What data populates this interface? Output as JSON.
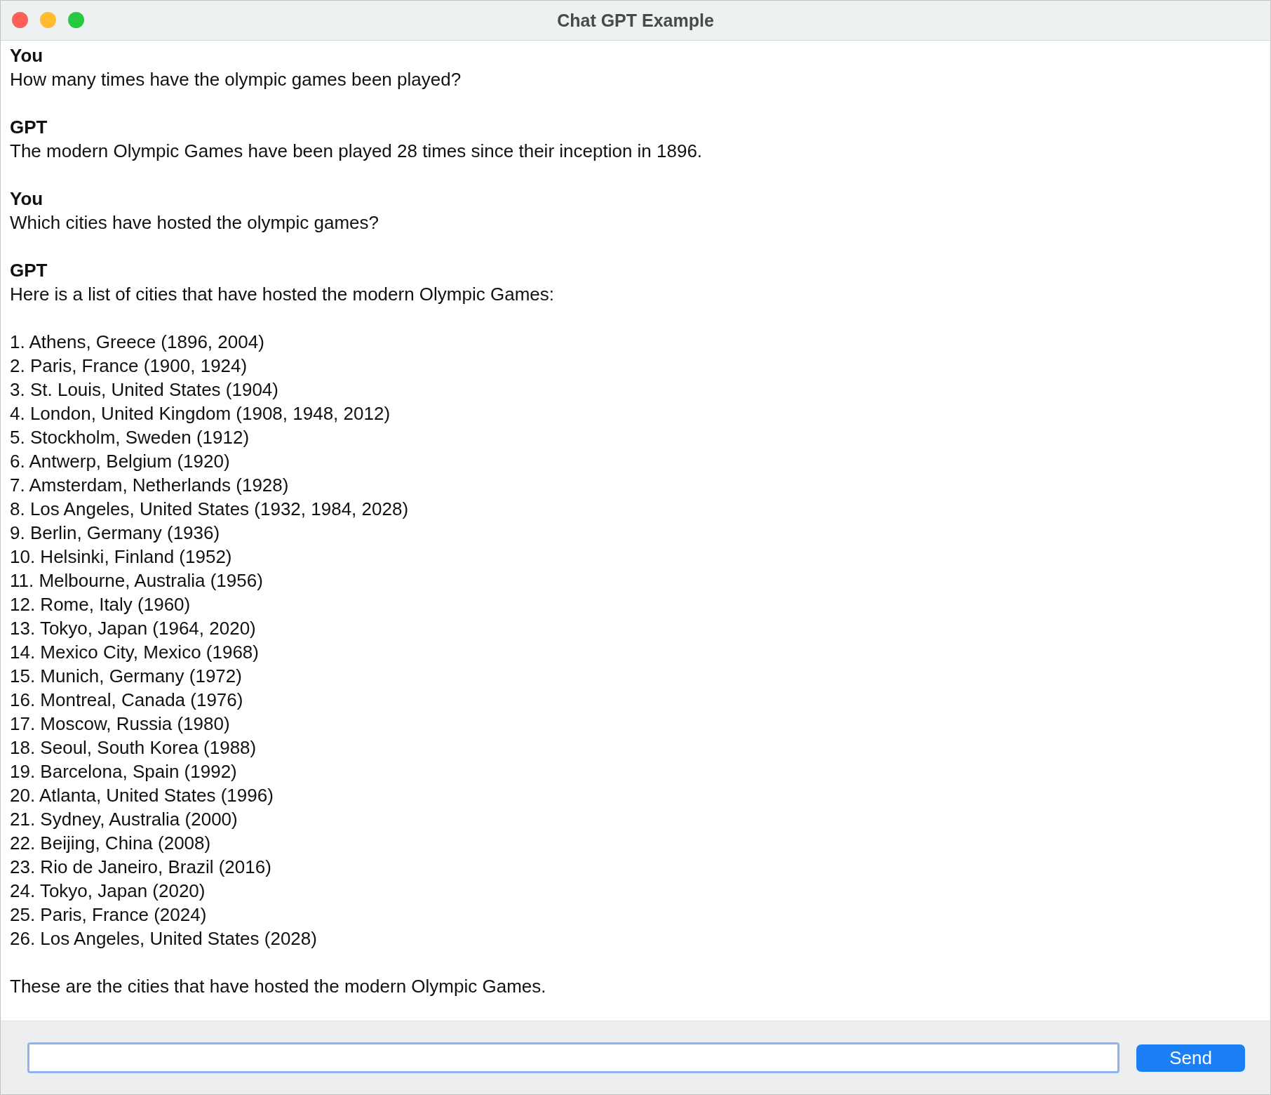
{
  "window": {
    "title": "Chat GPT Example"
  },
  "messages": [
    {
      "author": "You",
      "blocks": [
        {
          "kind": "text",
          "text": "How many times have the olympic games been played?"
        }
      ]
    },
    {
      "author": "GPT",
      "blocks": [
        {
          "kind": "text",
          "text": "The modern Olympic Games have been played 28 times since their inception in 1896."
        }
      ]
    },
    {
      "author": "You",
      "blocks": [
        {
          "kind": "text",
          "text": "Which cities have hosted the olympic games?"
        }
      ]
    },
    {
      "author": "GPT",
      "blocks": [
        {
          "kind": "text",
          "text": "Here is a list of cities that have hosted the modern Olympic Games:"
        },
        {
          "kind": "list",
          "items": [
            "1. Athens, Greece (1896, 2004)",
            "2. Paris, France (1900, 1924)",
            "3. St. Louis, United States (1904)",
            "4. London, United Kingdom (1908, 1948, 2012)",
            "5. Stockholm, Sweden (1912)",
            "6. Antwerp, Belgium (1920)",
            "7. Amsterdam, Netherlands (1928)",
            "8. Los Angeles, United States (1932, 1984, 2028)",
            "9. Berlin, Germany (1936)",
            "10. Helsinki, Finland (1952)",
            "11. Melbourne, Australia (1956)",
            "12. Rome, Italy (1960)",
            "13. Tokyo, Japan (1964, 2020)",
            "14. Mexico City, Mexico (1968)",
            "15. Munich, Germany (1972)",
            "16. Montreal, Canada (1976)",
            "17. Moscow, Russia (1980)",
            "18. Seoul, South Korea (1988)",
            "19. Barcelona, Spain (1992)",
            "20. Atlanta, United States (1996)",
            "21. Sydney, Australia (2000)",
            "22. Beijing, China (2008)",
            "23. Rio de Janeiro, Brazil (2016)",
            "24. Tokyo, Japan (2020)",
            "25. Paris, France (2024)",
            "26. Los Angeles, United States (2028)"
          ]
        },
        {
          "kind": "text",
          "text": "These are the cities that have hosted the modern Olympic Games."
        }
      ]
    }
  ],
  "composer": {
    "button": "Send"
  }
}
